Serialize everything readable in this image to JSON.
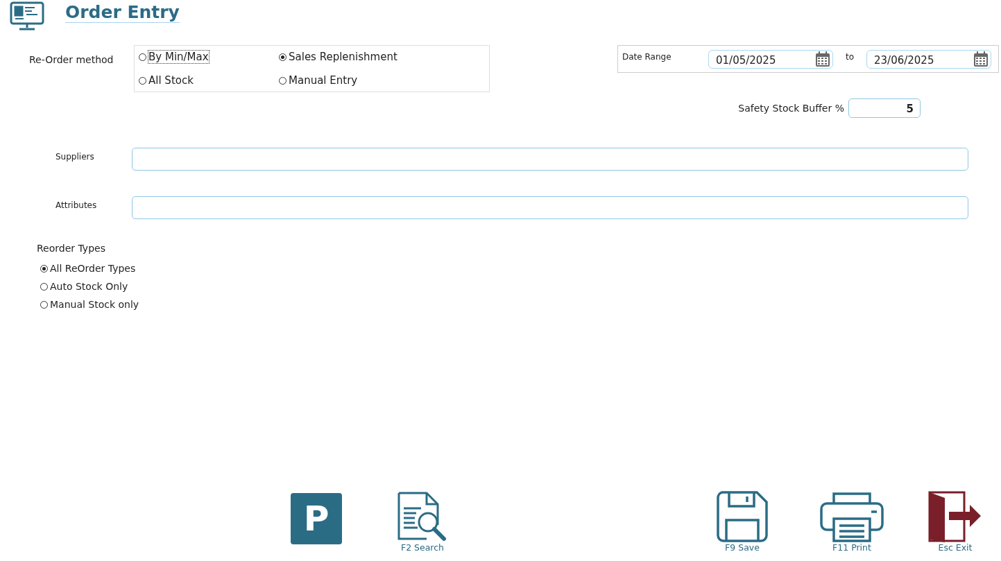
{
  "header": {
    "title": "Order Entry"
  },
  "reorder_method": {
    "label": "Re-Order method",
    "options": [
      {
        "label": "By Min/Max",
        "selected": false,
        "focused": true
      },
      {
        "label": "Sales Replenishment",
        "selected": true,
        "focused": false
      },
      {
        "label": "All Stock",
        "selected": false,
        "focused": false
      },
      {
        "label": "Manual Entry",
        "selected": false,
        "focused": false
      }
    ]
  },
  "date_range": {
    "label": "Date Range",
    "from": "01/05/2025",
    "separator": "to",
    "to": "23/06/2025"
  },
  "safety_stock": {
    "label": "Safety Stock Buffer %",
    "value": "5"
  },
  "fields": [
    {
      "label": "Suppliers"
    },
    {
      "label": "Attributes"
    }
  ],
  "reorder_types": {
    "title": "Reorder Types",
    "options": [
      {
        "label": "All ReOrder Types",
        "selected": true
      },
      {
        "label": "Auto Stock Only",
        "selected": false
      },
      {
        "label": "Manual Stock only",
        "selected": false
      }
    ]
  },
  "toolbar": [
    {
      "kind": "p",
      "glyph": "P"
    },
    {
      "kind": "search",
      "label": "F2 Search"
    },
    {
      "kind": "save",
      "label": "F9 Save"
    },
    {
      "kind": "print",
      "label": "F11 Print"
    },
    {
      "kind": "exit",
      "label": "Esc Exit"
    }
  ]
}
